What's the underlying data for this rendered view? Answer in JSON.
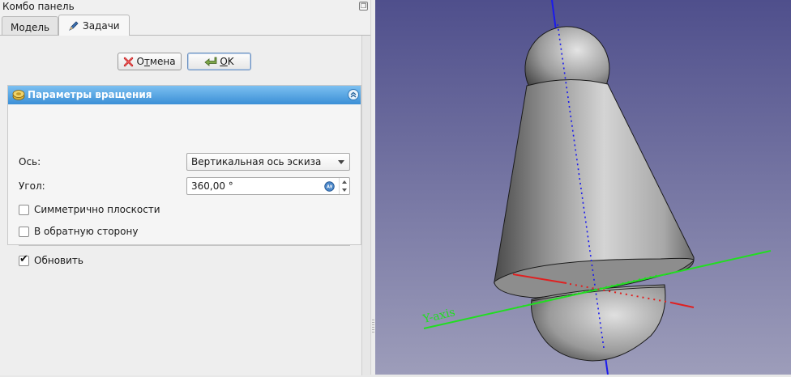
{
  "panel": {
    "title": "Комбо панель",
    "tabs": [
      {
        "label": "Модель",
        "active": false
      },
      {
        "label": "Задачи",
        "active": true
      }
    ]
  },
  "dialog": {
    "cancel": {
      "pre": "О",
      "accel": "т",
      "post": "мена"
    },
    "ok": {
      "accel": "O",
      "post": "K"
    }
  },
  "revolution": {
    "title": "Параметры вращения",
    "axis_label": "Ось:",
    "axis_value": "Вертикальная ось эскиза",
    "angle_label": "Угол:",
    "angle_value": "360,00 °",
    "symmetric_label": "Симметрично плоскости",
    "symmetric_checked": false,
    "reversed_label": "В обратную сторону",
    "reversed_checked": false,
    "update_label": "Обновить",
    "update_checked": true
  },
  "viewport": {
    "axis_label": "Y-axis",
    "bg_top": "#4f4f8c",
    "bg_bottom": "#9d9dba"
  },
  "colors": {
    "header_light": "#7cc0f1",
    "header_dark": "#3b8fd6",
    "axis_x": "#e02020",
    "axis_y": "#22dd22",
    "axis_z": "#1a1aee"
  }
}
